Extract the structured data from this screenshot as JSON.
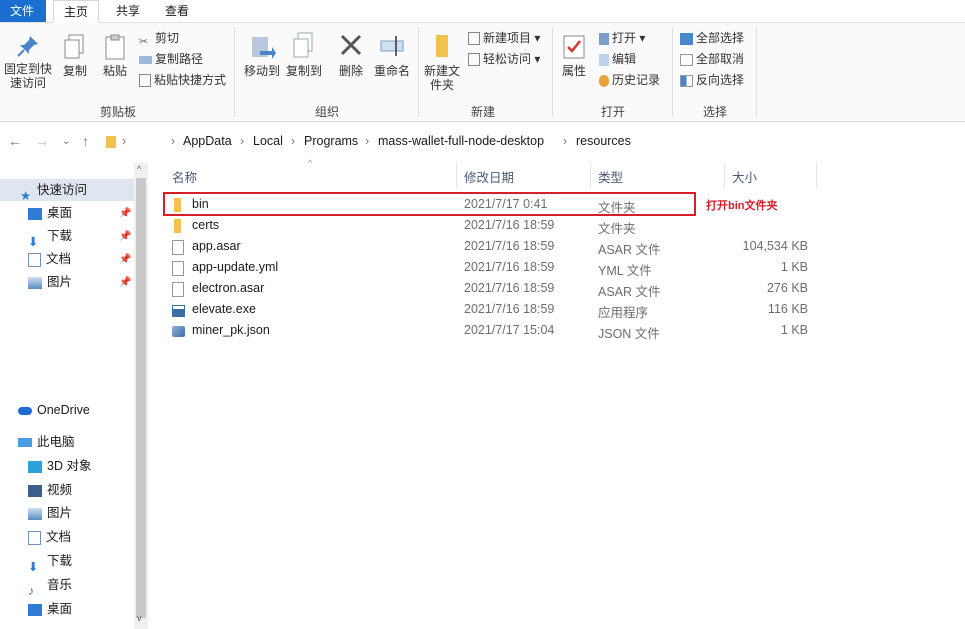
{
  "tabs": [
    "文件",
    "主页",
    "共享",
    "查看"
  ],
  "ribbon": {
    "clipboard": {
      "pin_label": "固定到快速访问",
      "copy_label": "复制",
      "paste_label": "粘贴",
      "cut_label": "剪切",
      "copy_path_label": "复制路径",
      "paste_shortcut_label": "粘贴快捷方式",
      "group_label": "剪贴板"
    },
    "organize": {
      "move_to_label": "移动到",
      "copy_to_label": "复制到",
      "delete_label": "删除",
      "rename_label": "重命名",
      "group_label": "组织"
    },
    "new": {
      "new_folder_label": "新建文件夹",
      "new_item_label": "新建项目",
      "easy_access_label": "轻松访问",
      "group_label": "新建"
    },
    "open": {
      "properties_label": "属性",
      "open_label": "打开",
      "edit_label": "编辑",
      "history_label": "历史记录",
      "group_label": "打开"
    },
    "select": {
      "select_all_label": "全部选择",
      "select_none_label": "全部取消",
      "invert_label": "反向选择",
      "group_label": "选择"
    }
  },
  "breadcrumb": [
    "AppData",
    "Local",
    "Programs",
    "mass-wallet-full-node-desktop",
    "resources"
  ],
  "nav": {
    "quick_access": "快速访问",
    "quick_items": [
      "桌面",
      "下载",
      "文档",
      "图片"
    ],
    "onedrive": "OneDrive",
    "this_pc": "此电脑",
    "pc_items": [
      "3D 对象",
      "视频",
      "图片",
      "文档",
      "下载",
      "音乐",
      "桌面"
    ]
  },
  "columns": {
    "name": "名称",
    "date": "修改日期",
    "type": "类型",
    "size": "大小"
  },
  "files": [
    {
      "name": "bin",
      "date": "2021/7/17 0:41",
      "type": "文件夹",
      "size": "",
      "icon": "folder-icon"
    },
    {
      "name": "certs",
      "date": "2021/7/16 18:59",
      "type": "文件夹",
      "size": "",
      "icon": "folder-icon"
    },
    {
      "name": "app.asar",
      "date": "2021/7/16 18:59",
      "type": "ASAR 文件",
      "size": "104,534 KB",
      "icon": "file-icon"
    },
    {
      "name": "app-update.yml",
      "date": "2021/7/16 18:59",
      "type": "YML 文件",
      "size": "1 KB",
      "icon": "file-icon"
    },
    {
      "name": "electron.asar",
      "date": "2021/7/16 18:59",
      "type": "ASAR 文件",
      "size": "276 KB",
      "icon": "file-icon"
    },
    {
      "name": "elevate.exe",
      "date": "2021/7/16 18:59",
      "type": "应用程序",
      "size": "116 KB",
      "icon": "exe-icon"
    },
    {
      "name": "miner_pk.json",
      "date": "2021/7/17 15:04",
      "type": "JSON 文件",
      "size": "1 KB",
      "icon": "json-icon"
    }
  ],
  "annotation": "打开bin文件夹",
  "colors": {
    "accent": "#1a6fd0",
    "folder": "#f2c14e",
    "highlight": "#d81e2b"
  }
}
